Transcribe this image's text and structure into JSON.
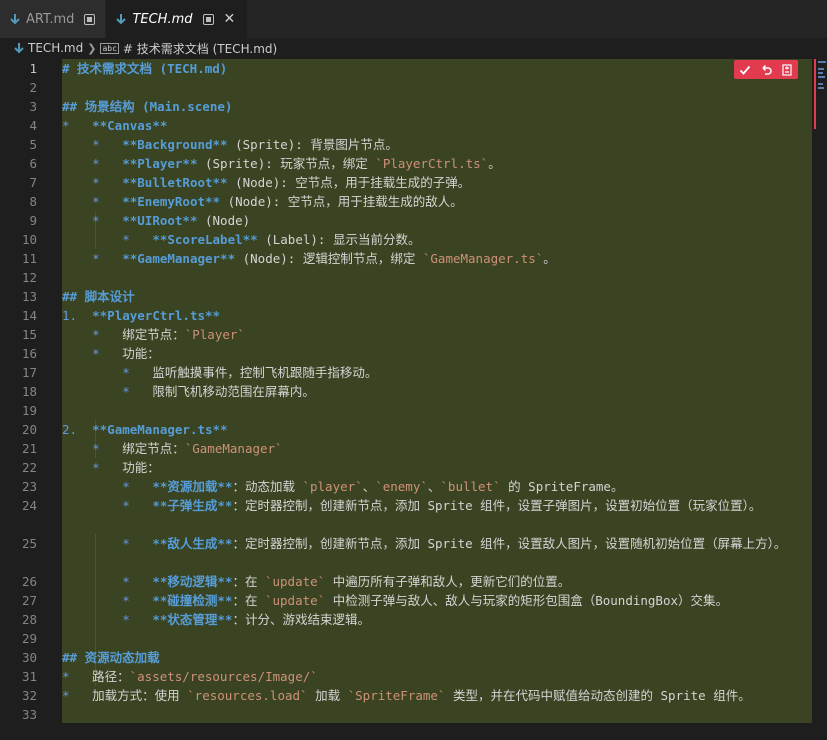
{
  "tabs": [
    {
      "label": "ART.md",
      "active": false
    },
    {
      "label": "TECH.md",
      "active": true
    }
  ],
  "breadcrumb": {
    "file": "TECH.md",
    "symbol": "# 技术需求文档 (TECH.md)"
  },
  "editor": {
    "current_line": 1,
    "line_numbers": [
      "1",
      "2",
      "3",
      "4",
      "5",
      "6",
      "7",
      "8",
      "9",
      "10",
      "11",
      "12",
      "13",
      "14",
      "15",
      "16",
      "17",
      "18",
      "19",
      "20",
      "21",
      "22",
      "23",
      "24",
      "25",
      "26",
      "27",
      "28",
      "29",
      "30",
      "31",
      "32",
      "33"
    ],
    "lines": {
      "l1": "# 技术需求文档 (TECH.md)",
      "l3": "## 场景结构 (Main.scene)",
      "l4_bullet": "*",
      "l4_text": "**Canvas**",
      "l5_bullet": "*",
      "l5_bold": "**Background**",
      "l5_rest": " (Sprite): 背景图片节点。",
      "l6_bullet": "*",
      "l6_bold": "**Player**",
      "l6_rest": " (Sprite): 玩家节点，绑定 ",
      "l6_code": "`PlayerCtrl.ts`",
      "l6_end": "。",
      "l7_bullet": "*",
      "l7_bold": "**BulletRoot**",
      "l7_rest": " (Node): 空节点，用于挂载生成的子弹。",
      "l8_bullet": "*",
      "l8_bold": "**EnemyRoot**",
      "l8_rest": " (Node): 空节点，用于挂载生成的敌人。",
      "l9_bullet": "*",
      "l9_bold": "**UIRoot**",
      "l9_rest": " (Node)",
      "l10_bullet": "*",
      "l10_bold": "**ScoreLabel**",
      "l10_rest": " (Label): 显示当前分数。",
      "l11_bullet": "*",
      "l11_bold": "**GameManager**",
      "l11_rest": " (Node): 逻辑控制节点，绑定 ",
      "l11_code": "`GameManager.ts`",
      "l11_end": "。",
      "l13": "## 脚本设计",
      "l14_num": "1.",
      "l14_bold": "**PlayerCtrl.ts**",
      "l15_bullet": "*",
      "l15_text": "绑定节点：",
      "l15_code": "`Player`",
      "l16_bullet": "*",
      "l16_text": "功能：",
      "l17_bullet": "*",
      "l17_text": "监听触摸事件，控制飞机跟随手指移动。",
      "l18_bullet": "*",
      "l18_text": "限制飞机移动范围在屏幕内。",
      "l20_num": "2.",
      "l20_bold": "**GameManager.ts**",
      "l21_bullet": "*",
      "l21_text": "绑定节点：",
      "l21_code": "`GameManager`",
      "l22_bullet": "*",
      "l22_text": "功能：",
      "l23_bullet": "*",
      "l23_bold": "**资源加载**",
      "l23_a": "：动态加载 ",
      "l23_c1": "`player`",
      "l23_b": "、",
      "l23_c2": "`enemy`",
      "l23_d": "、",
      "l23_c3": "`bullet`",
      "l23_e": " 的 SpriteFrame。",
      "l24_bullet": "*",
      "l24_bold": "**子弹生成**",
      "l24_rest": "：定时器控制，创建新节点，添加 Sprite 组件，设置子弹图片，设置初始位置（玩家位置）。",
      "l25_bullet": "*",
      "l25_bold": "**敌人生成**",
      "l25_rest": "：定时器控制，创建新节点，添加 Sprite 组件，设置敌人图片，设置随机初始位置（屏幕上方）。",
      "l26_bullet": "*",
      "l26_bold": "**移动逻辑**",
      "l26_a": "：在 ",
      "l26_code": "`update`",
      "l26_b": " 中遍历所有子弹和敌人，更新它们的位置。",
      "l27_bullet": "*",
      "l27_bold": "**碰撞检测**",
      "l27_a": "：在 ",
      "l27_code": "`update`",
      "l27_b": " 中检测子弹与敌人、敌人与玩家的矩形包围盒（BoundingBox）交集。",
      "l28_bullet": "*",
      "l28_bold": "**状态管理**",
      "l28_rest": "：计分、游戏结束逻辑。",
      "l30": "## 资源动态加载",
      "l31_bullet": "*",
      "l31_text": "路径：",
      "l31_code": "`assets/resources/Image/`",
      "l32_bullet": "*",
      "l32_a": "加载方式：使用 ",
      "l32_c1": "`resources.load`",
      "l32_b": " 加载 ",
      "l32_c2": "`SpriteFrame`",
      "l32_c": " 类型，并在代码中赋值给动态创建的 Sprite 组件。"
    }
  },
  "inline_actions": [
    "accept-icon",
    "undo-icon",
    "diff-icon"
  ],
  "colors": {
    "accent": "#e23a4f",
    "heading": "#569cd6",
    "code": "#ce9178",
    "selection_bg": "#3a4422"
  }
}
